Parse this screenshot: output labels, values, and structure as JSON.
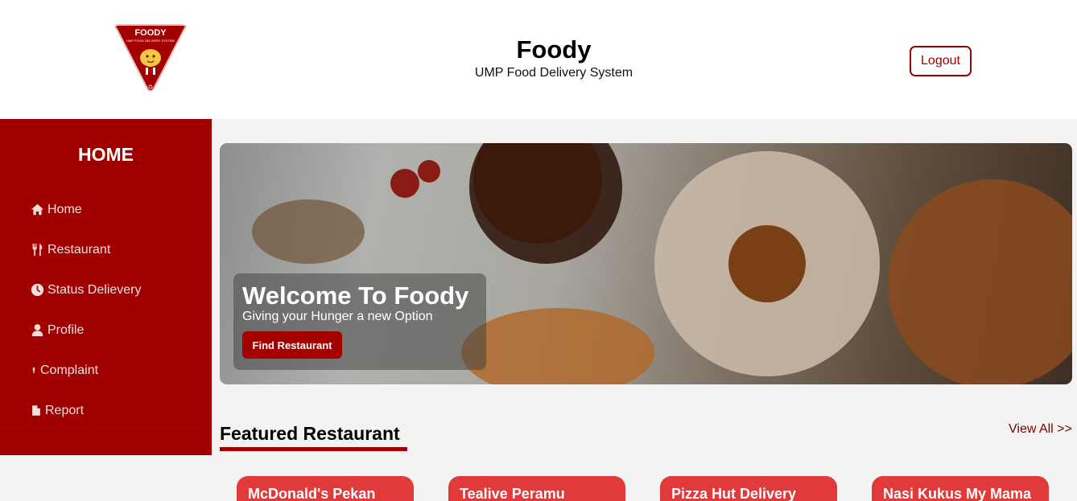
{
  "header": {
    "logo": {
      "text": "FOODY",
      "tagline": "UMP FOOD DELIVERY SYSTEM"
    },
    "title": "Foody",
    "subtitle": "UMP Food Delivery System",
    "logout_label": "Logout"
  },
  "sidebar": {
    "title": "HOME",
    "items": [
      {
        "label": "Home",
        "icon": "home-icon"
      },
      {
        "label": "Restaurant",
        "icon": "utensils-icon"
      },
      {
        "label": "Status Delievery",
        "icon": "clock-icon"
      },
      {
        "label": "Profile",
        "icon": "user-icon"
      },
      {
        "label": "Complaint",
        "icon": "exclamation-icon"
      },
      {
        "label": "Report",
        "icon": "file-icon"
      }
    ]
  },
  "banner": {
    "title": "Welcome To Foody",
    "subtitle": "Giving your Hunger a new Option",
    "button_label": "Find Restaurant"
  },
  "featured": {
    "title": "Featured Restaurant",
    "view_all": "View All >>",
    "restaurants": [
      "McDonald's Pekan",
      "Tealive Peramu",
      "Pizza Hut Delivery",
      "Nasi Kukus My Mama"
    ]
  },
  "colors": {
    "brand": "#a00000",
    "card": "#e03a3a",
    "background": "#f3f3f3"
  }
}
